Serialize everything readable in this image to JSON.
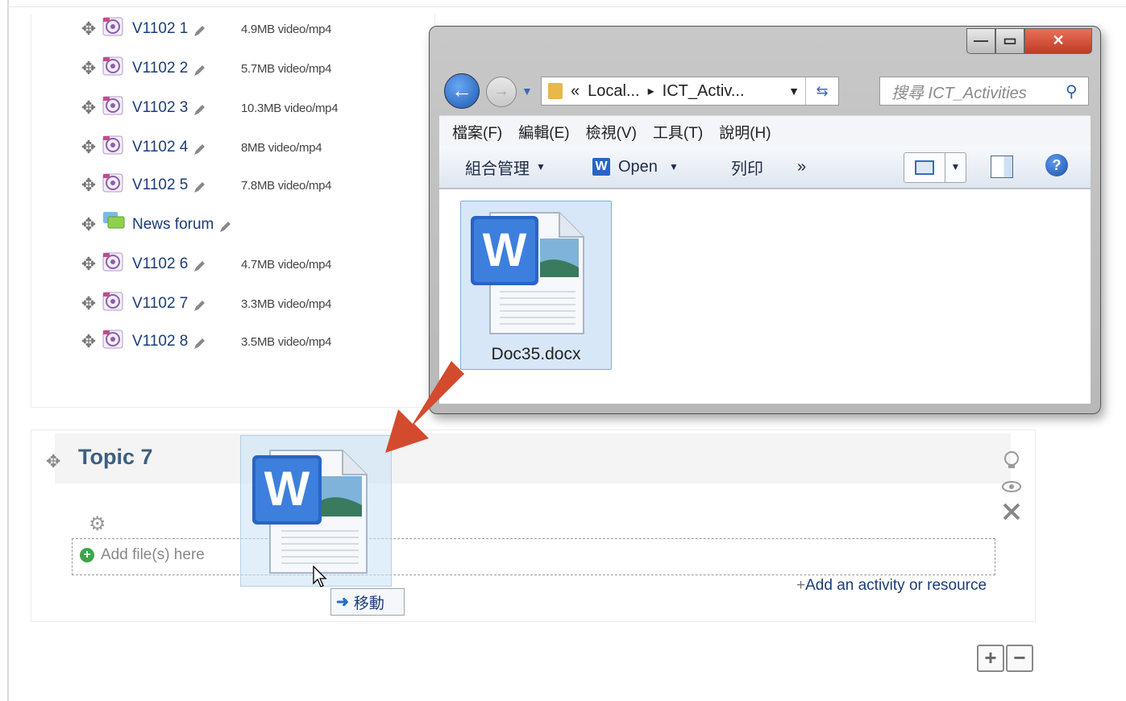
{
  "course": {
    "activities": [
      {
        "name": "V1102 1",
        "meta": "4.9MB video/mp4",
        "type": "video"
      },
      {
        "name": "V1102 2",
        "meta": "5.7MB video/mp4",
        "type": "video"
      },
      {
        "name": "V1102 3",
        "meta": "10.3MB video/mp4",
        "type": "video"
      },
      {
        "name": "V1102 4",
        "meta": "8MB video/mp4",
        "type": "video"
      },
      {
        "name": "V1102 5",
        "meta": "7.8MB video/mp4",
        "type": "video"
      },
      {
        "name": "News forum",
        "meta": "",
        "type": "forum"
      },
      {
        "name": "V1102 6",
        "meta": "4.7MB video/mp4",
        "type": "video"
      },
      {
        "name": "V1102 7",
        "meta": "3.3MB video/mp4",
        "type": "video"
      },
      {
        "name": "V1102 8",
        "meta": "3.5MB video/mp4",
        "type": "video"
      }
    ],
    "topic_title": "Topic 7",
    "add_files_label": "Add file(s) here",
    "add_activity_label": "Add an activity or resource"
  },
  "drag": {
    "tooltip_label": "移動",
    "icon": "word-document-icon"
  },
  "explorer": {
    "breadcrumb_prefix": "«",
    "breadcrumb_1": "Local...",
    "breadcrumb_2": "ICT_Activ...",
    "search_placeholder": "搜尋 ICT_Activities",
    "menu": [
      "檔案(F)",
      "編輯(E)",
      "檢視(V)",
      "工具(T)",
      "說明(H)"
    ],
    "cmd_organize": "組合管理",
    "cmd_open": "Open",
    "cmd_print": "列印",
    "cmd_more": "»",
    "file_name": "Doc35.docx"
  },
  "colors": {
    "link": "#1b3d78",
    "arrow": "#d44a2e",
    "selection": "#d8e7f8"
  }
}
